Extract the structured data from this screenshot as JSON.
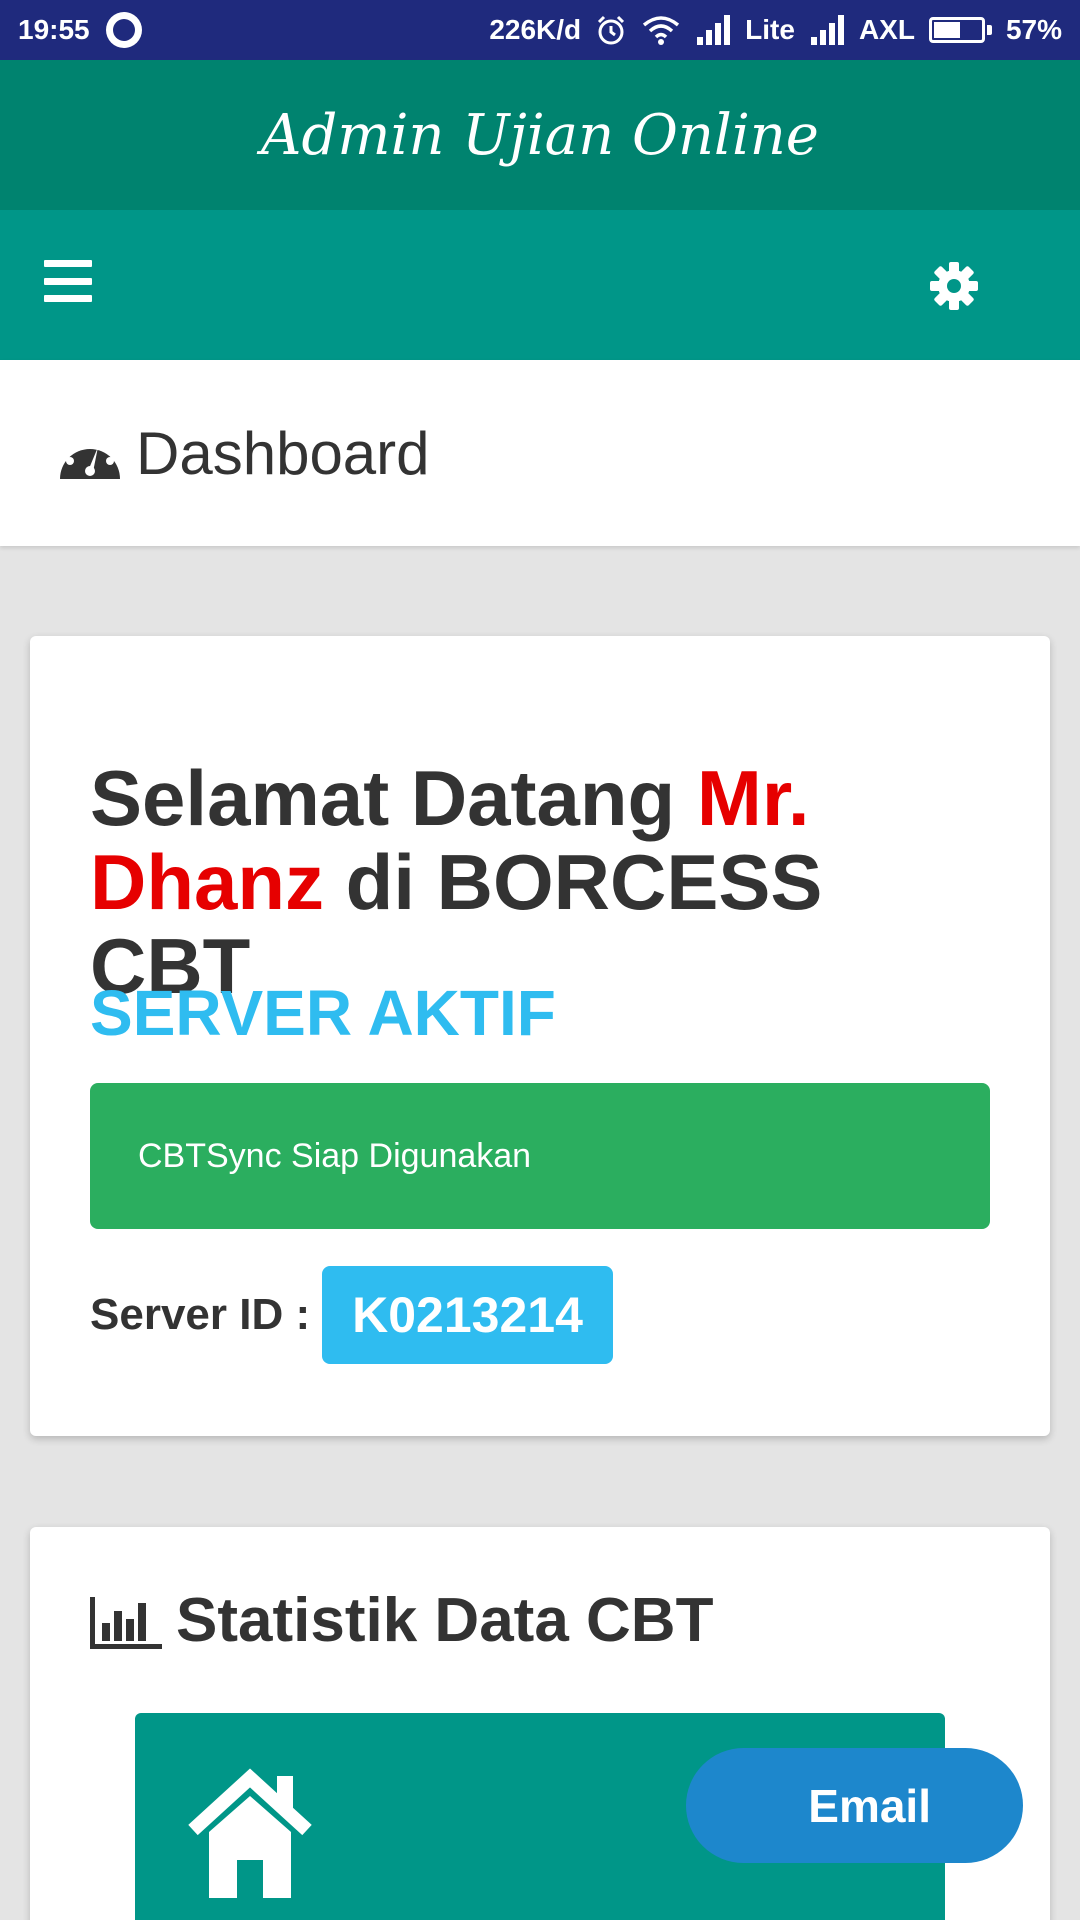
{
  "status_bar": {
    "time": "19:55",
    "net_speed": "226K/d",
    "carrier1": "Lite",
    "carrier2": "AXL",
    "battery_text": "57%",
    "battery_level": 0.57,
    "icons": [
      "blackberry-icon",
      "alarm-icon",
      "wifi-icon",
      "signal-icon",
      "signal-icon",
      "battery-icon"
    ]
  },
  "app": {
    "title": "Admin Ujian Online"
  },
  "nav": {
    "menu_icon": "hamburger-icon",
    "settings_icon": "gear-icon"
  },
  "header": {
    "icon": "dashboard-icon",
    "title": "Dashboard"
  },
  "welcome_card": {
    "greeting_prefix": "Selamat Datang ",
    "user_name": "Mr. Dhanz",
    "greeting_suffix": " di BORCESS CBT",
    "server_status": "SERVER AKTIF",
    "sync_message": "CBTSync Siap Digunakan",
    "server_id_label": "Server ID :",
    "server_id": "K0213214"
  },
  "stats_card": {
    "icon": "bar-chart-icon",
    "title": "Statistik Data CBT",
    "tile_icon": "home-icon"
  },
  "floating": {
    "email_label": "Email"
  },
  "colors": {
    "status_bar": "#1f2a7d",
    "title_bar": "#00836f",
    "nav_bar": "#009688",
    "name_red": "#e60000",
    "status_blue": "#2fbcf0",
    "alert_green": "#2bae5f",
    "email_button": "#1d87cc"
  }
}
